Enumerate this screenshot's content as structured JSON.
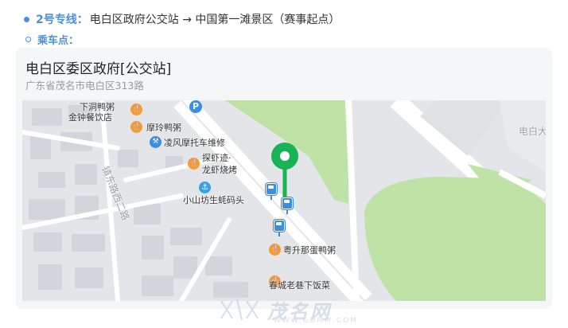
{
  "route": {
    "label": "2号专线：",
    "text": "电白区政府公交站 → 中国第一滩景区（赛事起点）"
  },
  "station": {
    "label": "乘车点："
  },
  "card": {
    "title": "电白区委区政府[公交站]",
    "address": "广东省茂名市电白区313路"
  },
  "map": {
    "labels": {
      "xiadong": "下洞鸭粥",
      "jinzhong": "金钟餐饮店",
      "moling": "摩玲鸭粥",
      "lingfeng": "凌风摩托车维修",
      "tanxiaji": "探虾迹·",
      "longxia": "龙虾烧烤",
      "road": "镇东路西二路",
      "xiaoshan": "小山坊生蚝码头",
      "yuesheng": "粤升那蛋鸭粥",
      "chuncheng": "春城老巷下饭菜",
      "dianbai": "电白大"
    },
    "marker_color": "#19b255",
    "green_color": "#b9e3a0",
    "road_color": "#ffffff"
  },
  "watermark": {
    "text": "茂名网",
    "url": "WWW.GDMM.COM"
  },
  "colors": {
    "accent": "#4a90e2",
    "food_poi": "#f39a3a",
    "bus_poi": "#3a8ee6"
  }
}
